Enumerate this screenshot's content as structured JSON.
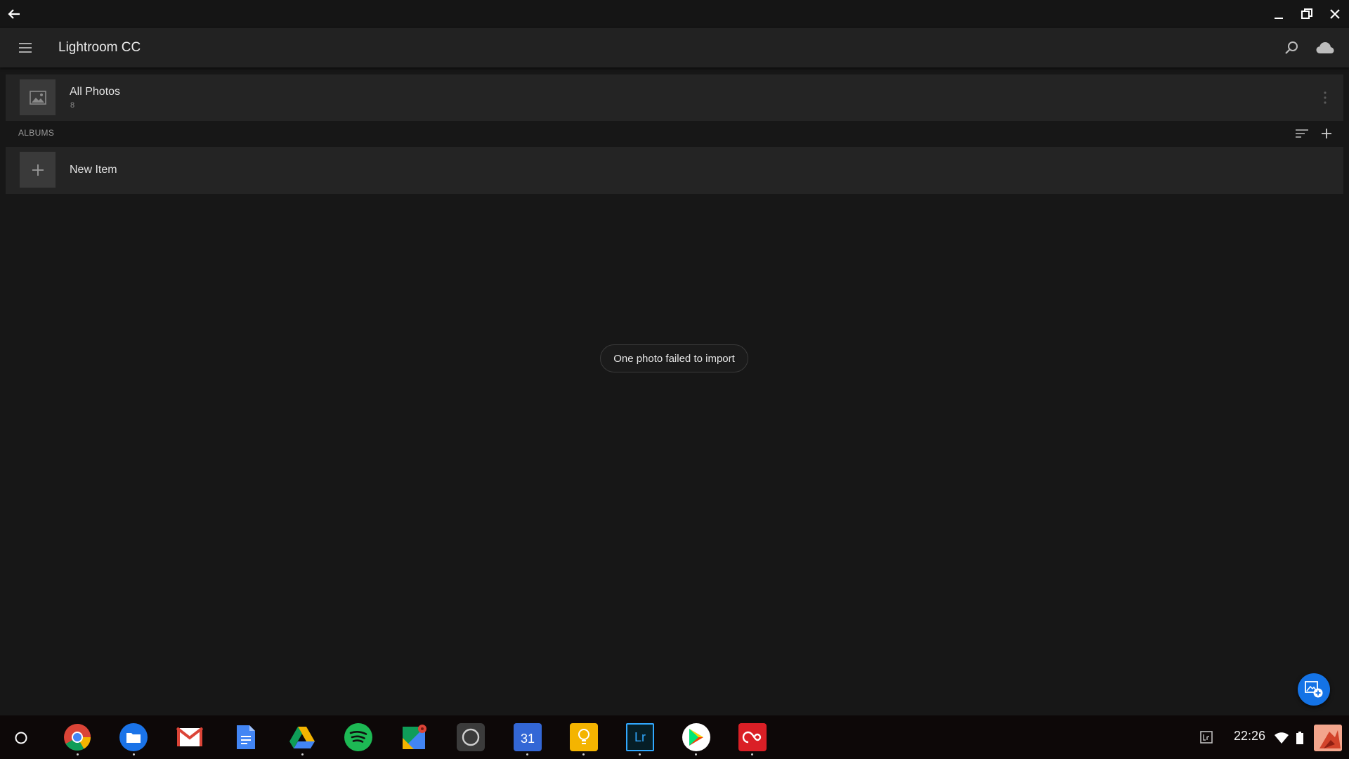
{
  "window": {
    "title": "Lightroom CC"
  },
  "library": {
    "all_photos": {
      "label": "All Photos",
      "count": "8"
    },
    "albums_header": "ALBUMS",
    "new_item_label": "New Item"
  },
  "toast": {
    "message": "One photo failed to import"
  },
  "taskbar": {
    "clock": "22:26",
    "calendar_day": "31",
    "lr_label": "Lr",
    "apps": [
      "launcher",
      "chrome",
      "files",
      "gmail",
      "docs",
      "drive",
      "spotify",
      "maps",
      "camera",
      "calendar",
      "keep",
      "lightroom",
      "play-store",
      "creative-cloud"
    ]
  },
  "colors": {
    "accent": "#1473e6",
    "background": "#171717",
    "appbar": "#222222"
  }
}
